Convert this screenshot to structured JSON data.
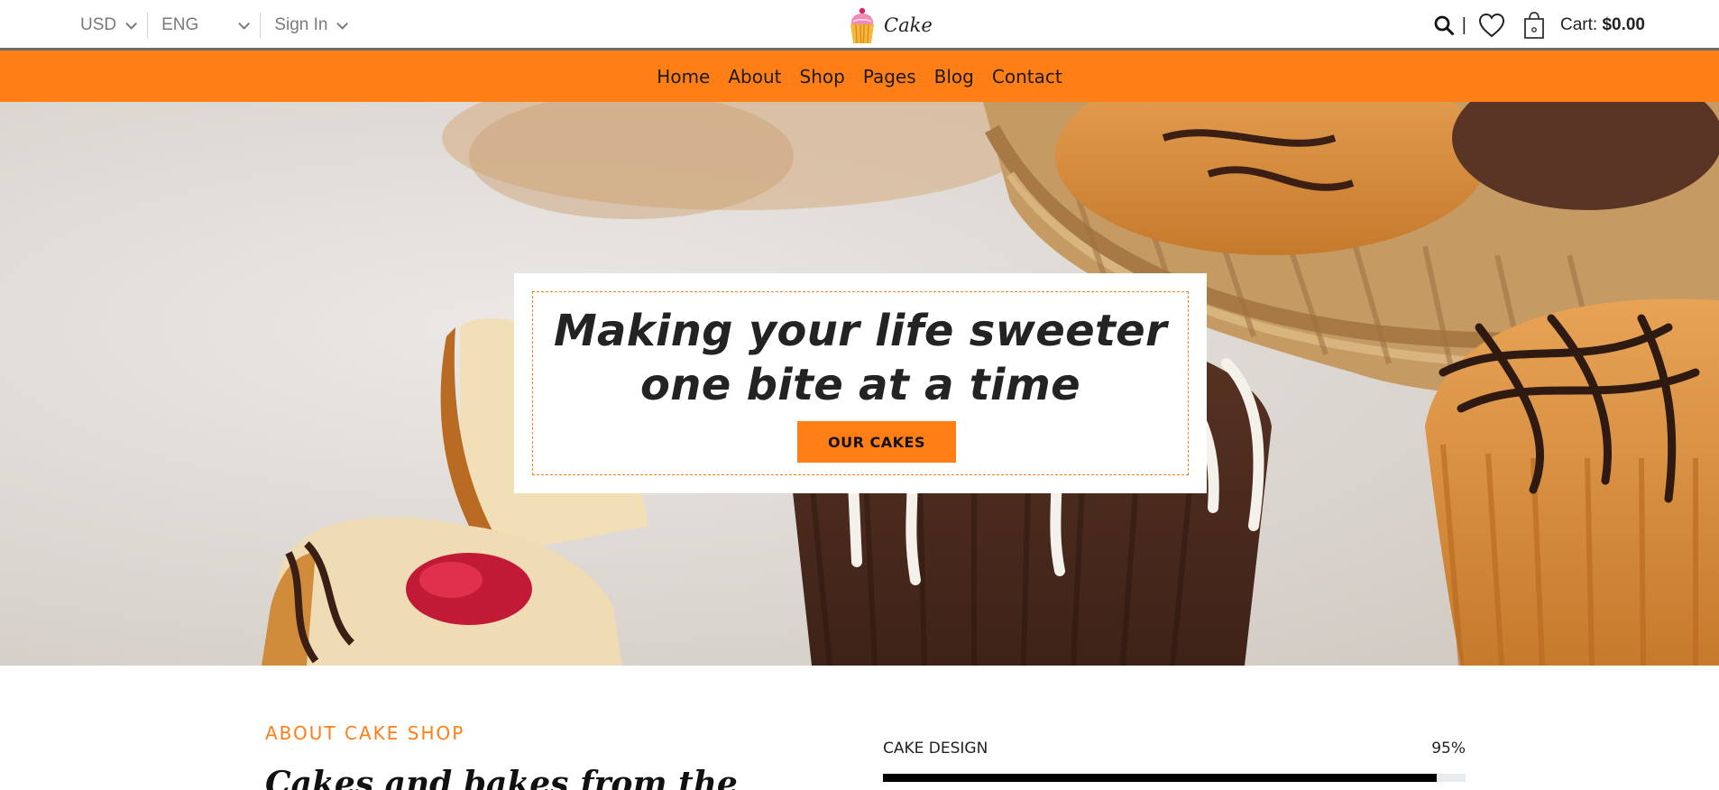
{
  "topbar": {
    "currency": "USD",
    "language": "ENG",
    "signin": "Sign In",
    "brand": "Cake",
    "cart_label": "Cart:",
    "cart_total": "$0.00",
    "divider": "|"
  },
  "nav": {
    "items": [
      "Home",
      "About",
      "Shop",
      "Pages",
      "Blog",
      "Contact"
    ]
  },
  "hero": {
    "title_line1": "Making your life sweeter",
    "title_line2": "one bite at a time",
    "button": "OUR CAKES"
  },
  "about": {
    "kicker": "ABOUT CAKE SHOP",
    "heading": "Cakes and bakes from the",
    "skill": {
      "label": "CAKE DESIGN",
      "percent_label": "95%",
      "percent": 95
    }
  },
  "colors": {
    "accent": "#ff7f16",
    "text": "#222222"
  },
  "icons": [
    "cupcake-logo-icon",
    "search-icon",
    "heart-icon",
    "shopping-bag-icon",
    "chevron-down-icon"
  ]
}
